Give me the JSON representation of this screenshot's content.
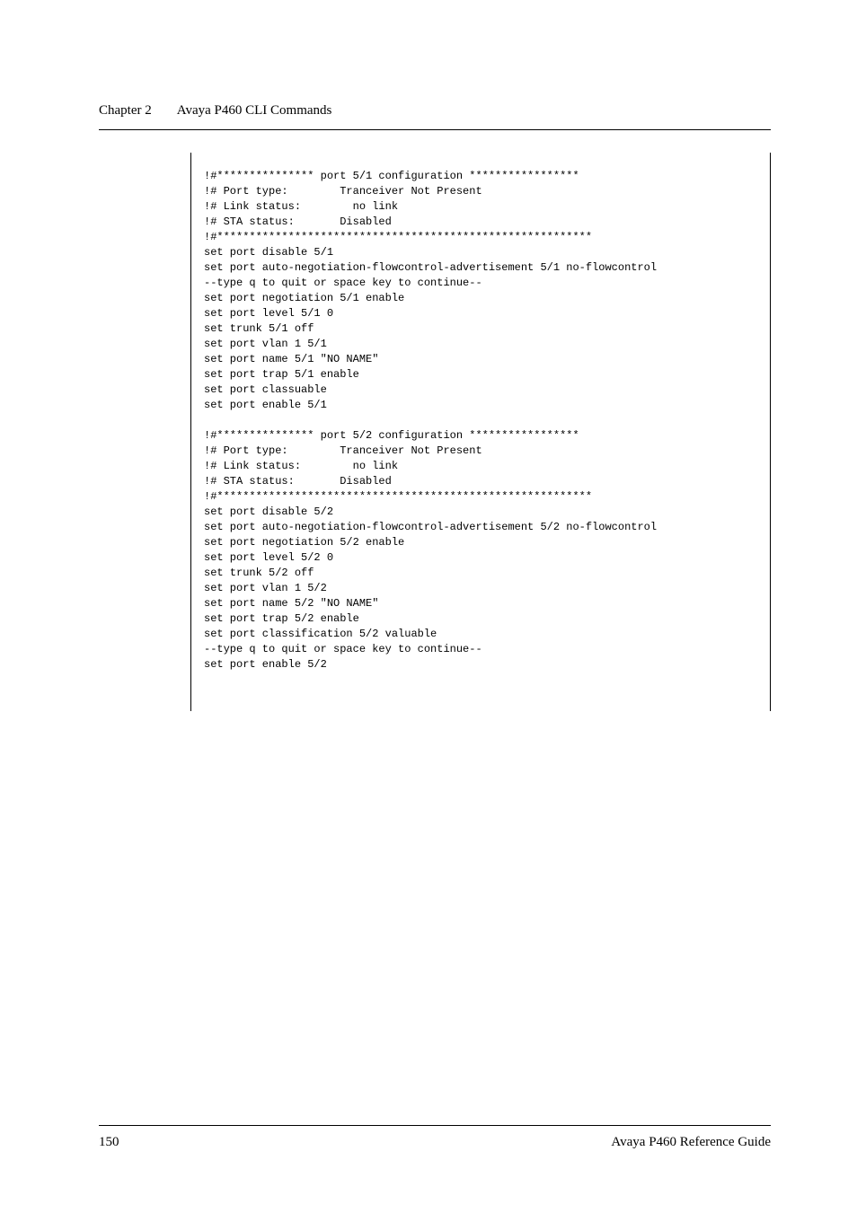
{
  "header": {
    "chapter_label": "Chapter 2",
    "chapter_title": "Avaya P460 CLI Commands"
  },
  "code": {
    "text": "!#*************** port 5/1 configuration *****************\n!# Port type:        Tranceiver Not Present\n!# Link status:        no link\n!# STA status:       Disabled\n!#**********************************************************\nset port disable 5/1\nset port auto-negotiation-flowcontrol-advertisement 5/1 no-flowcontrol\n--type q to quit or space key to continue--\nset port negotiation 5/1 enable\nset port level 5/1 0\nset trunk 5/1 off\nset port vlan 1 5/1\nset port name 5/1 \"NO NAME\"\nset port trap 5/1 enable\nset port classuable\nset port enable 5/1\n\n!#*************** port 5/2 configuration *****************\n!# Port type:        Tranceiver Not Present\n!# Link status:        no link\n!# STA status:       Disabled\n!#**********************************************************\nset port disable 5/2\nset port auto-negotiation-flowcontrol-advertisement 5/2 no-flowcontrol\nset port negotiation 5/2 enable\nset port level 5/2 0\nset trunk 5/2 off\nset port vlan 1 5/2\nset port name 5/2 \"NO NAME\"\nset port trap 5/2 enable\nset port classification 5/2 valuable\n--type q to quit or space key to continue--\nset port enable 5/2"
  },
  "footer": {
    "page_number": "150",
    "guide_title": "Avaya P460 Reference Guide"
  }
}
